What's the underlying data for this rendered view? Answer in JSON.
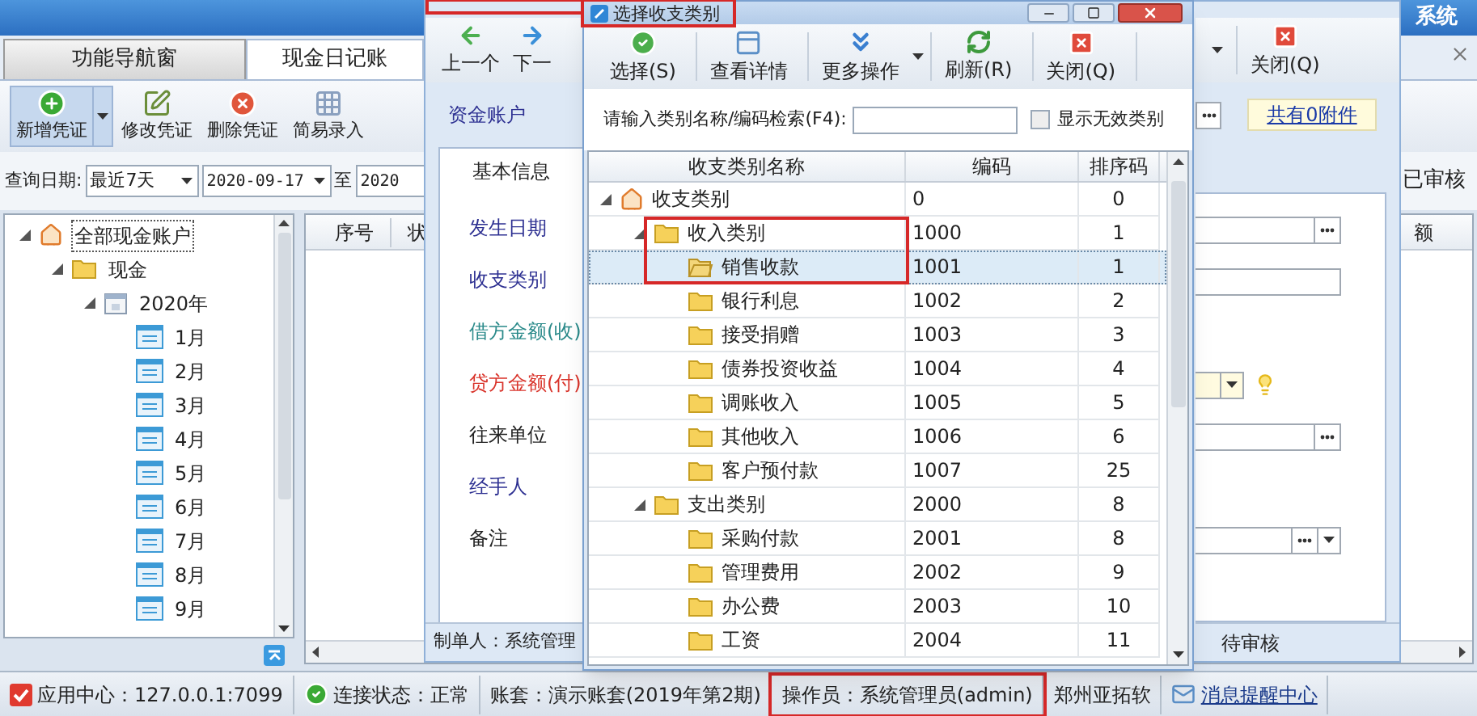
{
  "app": {
    "brand_text": "系统",
    "tabs": [
      {
        "label": "功能导航窗",
        "selected": false
      },
      {
        "label": "现金日记账",
        "selected": true
      }
    ],
    "toolbar": [
      {
        "label": "新增凭证",
        "kind": "add",
        "dropdown": true,
        "pressed": true
      },
      {
        "label": "修改凭证",
        "kind": "edit",
        "dropdown": false,
        "pressed": false
      },
      {
        "label": "删除凭证",
        "kind": "delete",
        "dropdown": false,
        "pressed": false
      },
      {
        "label": "简易录入",
        "kind": "grid",
        "dropdown": false,
        "pressed": false
      }
    ],
    "query": {
      "label": "查询日期:",
      "range": "最近7天",
      "start": "2020-09-17",
      "separator": "至",
      "end": "2020"
    },
    "audit_status": "已审核",
    "account_tree": [
      {
        "label": "全部现金账户",
        "kind": "home",
        "expanded": true,
        "selected": true,
        "children": [
          {
            "label": "现金",
            "kind": "folder",
            "expanded": true,
            "selected": false,
            "children": [
              {
                "label": "2020年",
                "kind": "calendar",
                "expanded": true,
                "selected": false,
                "children": [
                  {
                    "label": "1月",
                    "kind": "month",
                    "selected": false
                  },
                  {
                    "label": "2月",
                    "kind": "month",
                    "selected": false
                  },
                  {
                    "label": "3月",
                    "kind": "month",
                    "selected": false
                  },
                  {
                    "label": "4月",
                    "kind": "month",
                    "selected": false
                  },
                  {
                    "label": "5月",
                    "kind": "month",
                    "selected": false
                  },
                  {
                    "label": "6月",
                    "kind": "month",
                    "selected": false
                  },
                  {
                    "label": "7月",
                    "kind": "month",
                    "selected": false
                  },
                  {
                    "label": "8月",
                    "kind": "month",
                    "selected": false
                  },
                  {
                    "label": "9月",
                    "kind": "month",
                    "selected": false
                  }
                ]
              }
            ]
          }
        ]
      }
    ],
    "grid": {
      "columns": [
        "序号",
        "状"
      ],
      "last_column": "额"
    }
  },
  "voucher_dialog": {
    "title_highlighted": true,
    "toolbar": [
      {
        "label": "上一个",
        "kind": "prev"
      },
      {
        "label": "下一",
        "kind": "next"
      }
    ],
    "close_label": "关闭(Q)",
    "account_label": "资金账户",
    "attachment_link": "共有0附件",
    "tab": "基本信息",
    "fields": [
      {
        "label": "发生日期",
        "color": "#2e3192",
        "kind": "lookup"
      },
      {
        "label": "收支类别",
        "color": "#2e3192",
        "kind": "text"
      },
      {
        "label": "借方金额(收)",
        "color": "#2a8a8a",
        "kind": "none"
      },
      {
        "label": "贷方金额(付)",
        "color": "#d9342b",
        "kind": "dropdown"
      },
      {
        "label": "往来单位",
        "color": "#222222",
        "kind": "lookup"
      },
      {
        "label": "经手人",
        "color": "#2e3192",
        "kind": "none"
      },
      {
        "label": "备注",
        "color": "#222222",
        "kind": "lookup_dropdown"
      }
    ],
    "creator": "制单人：系统管理",
    "review_status": "待审核"
  },
  "category_dialog": {
    "title": "选择收支类别",
    "title_highlighted": true,
    "toolbar": [
      {
        "label": "选择(S)",
        "kind": "check",
        "dropdown": false
      },
      {
        "label": "查看详情",
        "kind": "details",
        "dropdown": false
      },
      {
        "label": "更多操作",
        "kind": "more",
        "dropdown": true
      },
      {
        "label": "刷新(R)",
        "kind": "refresh",
        "dropdown": false
      },
      {
        "label": "关闭(Q)",
        "kind": "close",
        "dropdown": false
      }
    ],
    "search": {
      "label": "请输入类别名称/编码检索(F4):"
    },
    "show_invalid": {
      "label": "显示无效类别",
      "checked": false
    },
    "columns": [
      "收支类别名称",
      "编码",
      "排序码"
    ],
    "rows": [
      {
        "name": "收支类别",
        "code": "0",
        "order": "0",
        "kind": "home",
        "expanded": true,
        "selected": false,
        "highlighted": false,
        "children": [
          {
            "name": "收入类别",
            "code": "1000",
            "order": "1",
            "kind": "folder",
            "expanded": true,
            "selected": false,
            "highlighted": true,
            "children": [
              {
                "name": "销售收款",
                "code": "1001",
                "order": "1",
                "kind": "folder_open",
                "selected": true,
                "highlighted": true
              },
              {
                "name": "银行利息",
                "code": "1002",
                "order": "2",
                "kind": "folder",
                "selected": false,
                "highlighted": false
              },
              {
                "name": "接受捐赠",
                "code": "1003",
                "order": "3",
                "kind": "folder",
                "selected": false,
                "highlighted": false
              },
              {
                "name": "债券投资收益",
                "code": "1004",
                "order": "4",
                "kind": "folder",
                "selected": false,
                "highlighted": false
              },
              {
                "name": "调账收入",
                "code": "1005",
                "order": "5",
                "kind": "folder",
                "selected": false,
                "highlighted": false
              },
              {
                "name": "其他收入",
                "code": "1006",
                "order": "6",
                "kind": "folder",
                "selected": false,
                "highlighted": false
              },
              {
                "name": "客户预付款",
                "code": "1007",
                "order": "25",
                "kind": "folder",
                "selected": false,
                "highlighted": false
              }
            ]
          },
          {
            "name": "支出类别",
            "code": "2000",
            "order": "8",
            "kind": "folder",
            "expanded": true,
            "selected": false,
            "highlighted": false,
            "children": [
              {
                "name": "采购付款",
                "code": "2001",
                "order": "8",
                "kind": "folder",
                "selected": false,
                "highlighted": false
              },
              {
                "name": "管理费用",
                "code": "2002",
                "order": "9",
                "kind": "folder",
                "selected": false,
                "highlighted": false
              },
              {
                "name": "办公费",
                "code": "2003",
                "order": "10",
                "kind": "folder",
                "selected": false,
                "highlighted": false
              },
              {
                "name": "工资",
                "code": "2004",
                "order": "11",
                "kind": "folder",
                "selected": false,
                "highlighted": false
              }
            ]
          }
        ]
      }
    ]
  },
  "status_bar": [
    {
      "kind": "app",
      "text": "应用中心：127.0.0.1:7099",
      "highlighted": false,
      "link": false
    },
    {
      "kind": "ok",
      "text": "连接状态：正常",
      "highlighted": false,
      "link": false
    },
    {
      "kind": "none",
      "text": "账套：演示账套(2019年第2期)",
      "highlighted": false,
      "link": false
    },
    {
      "kind": "none",
      "text": "操作员：系统管理员(admin)",
      "highlighted": true,
      "link": false
    },
    {
      "kind": "none",
      "text": "郑州亚拓软",
      "highlighted": false,
      "link": false
    },
    {
      "kind": "mail",
      "text": "消息提醒中心",
      "highlighted": false,
      "link": true
    }
  ]
}
